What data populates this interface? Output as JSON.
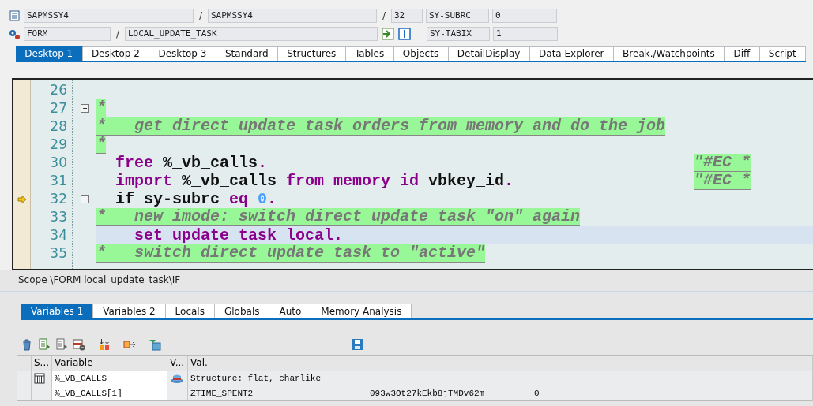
{
  "header": {
    "row_1": [
      {
        "kind": "field",
        "text": "SAPMSSY4"
      },
      {
        "kind": "sep",
        "text": "/"
      },
      {
        "kind": "field",
        "text": "SAPMSSY4"
      },
      {
        "kind": "sep",
        "text": "/"
      },
      {
        "kind": "field",
        "text": "32"
      },
      {
        "kind": "label",
        "text": "SY-SUBRC"
      },
      {
        "kind": "field",
        "text": "0"
      }
    ],
    "row_2": [
      {
        "kind": "field",
        "text": "FORM"
      },
      {
        "kind": "sep",
        "text": "/"
      },
      {
        "kind": "field",
        "text": "LOCAL_UPDATE_TASK"
      },
      {
        "kind": "label",
        "text": "SY-TABIX"
      },
      {
        "kind": "field",
        "text": "1"
      }
    ]
  },
  "desktop_tabs": [
    {
      "label": "Desktop 1",
      "selected": true
    },
    {
      "label": "Desktop 2",
      "selected": false
    },
    {
      "label": "Desktop 3",
      "selected": false
    },
    {
      "label": "Standard",
      "selected": false
    },
    {
      "label": "Structures",
      "selected": false
    },
    {
      "label": "Tables",
      "selected": false
    },
    {
      "label": "Objects",
      "selected": false
    },
    {
      "label": "DetailDisplay",
      "selected": false
    },
    {
      "label": "Data Explorer",
      "selected": false
    },
    {
      "label": "Break./Watchpoints",
      "selected": false
    },
    {
      "label": "Diff",
      "selected": false
    },
    {
      "label": "Script",
      "selected": false
    }
  ],
  "code_lines": [
    {
      "number": "26",
      "fold": false,
      "current": false,
      "highlighted": false
    },
    {
      "number": "27",
      "fold": true,
      "current": false,
      "highlighted": false,
      "tokens": [
        {
          "kind": "comment",
          "text": "*"
        }
      ]
    },
    {
      "number": "28",
      "fold": false,
      "current": false,
      "highlighted": false,
      "tokens": [
        {
          "kind": "comment",
          "text": "*   get direct update task orders from memory and do the job"
        }
      ]
    },
    {
      "number": "29",
      "fold": false,
      "current": false,
      "highlighted": false,
      "tokens": [
        {
          "kind": "comment",
          "text": "*"
        }
      ]
    },
    {
      "number": "30",
      "fold": false,
      "current": false,
      "highlighted": false,
      "tokens": [
        {
          "kind": "keyword",
          "text": "  free"
        },
        {
          "kind": "identifier",
          "text": " %_vb_calls"
        },
        {
          "kind": "punct",
          "text": "."
        }
      ],
      "pragma": "\"#EC *"
    },
    {
      "number": "31",
      "fold": false,
      "current": false,
      "highlighted": false,
      "tokens": [
        {
          "kind": "keyword",
          "text": "  import"
        },
        {
          "kind": "identifier",
          "text": " %_vb_calls"
        },
        {
          "kind": "keyword",
          "text": " from memory id"
        },
        {
          "kind": "identifier",
          "text": " vbkey_id"
        },
        {
          "kind": "punct",
          "text": "."
        }
      ],
      "pragma": "\"#EC *"
    },
    {
      "number": "32",
      "fold": true,
      "current": true,
      "highlighted": false,
      "tokens": [
        {
          "kind": "identifier",
          "text": "  if sy-subrc"
        },
        {
          "kind": "keyword",
          "text": " eq"
        },
        {
          "kind": "number",
          "text": " 0"
        },
        {
          "kind": "punct",
          "text": "."
        }
      ]
    },
    {
      "number": "33",
      "fold": false,
      "current": false,
      "highlighted": false,
      "tokens": [
        {
          "kind": "comment",
          "text": "*   new imode: switch direct update task \"on\" again"
        }
      ]
    },
    {
      "number": "34",
      "fold": false,
      "current": false,
      "highlighted": true,
      "tokens": [
        {
          "kind": "keyword",
          "text": "    set update task local."
        }
      ]
    },
    {
      "number": "35",
      "fold": false,
      "current": false,
      "highlighted": false,
      "tokens": [
        {
          "kind": "comment",
          "text": "*   switch direct update task to \"active\""
        }
      ]
    }
  ],
  "scope": "Scope \\FORM local_update_task\\IF",
  "variable_tabs": [
    {
      "label": "Variables 1",
      "selected": true
    },
    {
      "label": "Variables 2",
      "selected": false
    },
    {
      "label": "Locals",
      "selected": false
    },
    {
      "label": "Globals",
      "selected": false
    },
    {
      "label": "Auto",
      "selected": false
    },
    {
      "label": "Memory Analysis",
      "selected": false
    }
  ],
  "table": {
    "columns": [
      "S...",
      "Variable",
      "V...",
      "Val."
    ],
    "rows": [
      {
        "kind": "structure",
        "variable": "%_VB_CALLS",
        "value": [
          "Structure: flat, charlike"
        ]
      },
      {
        "kind": "component",
        "variable": "%_VB_CALLS[1]",
        "value": [
          "ZTIME_SPENT2",
          "093w3Ot27kEkb8jTMDv62m",
          "0"
        ]
      }
    ]
  }
}
